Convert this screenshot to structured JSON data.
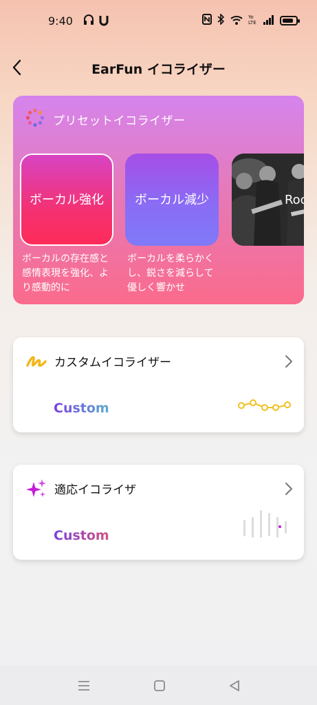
{
  "status_bar": {
    "time": "9:40",
    "battery_level": 0.85,
    "left_icons": [
      "headphones-icon",
      "magnet-icon"
    ],
    "right_icons": [
      "nfc-icon",
      "bluetooth-icon",
      "wifi-icon",
      "volte-icon",
      "signal-icon",
      "battery-icon"
    ]
  },
  "header": {
    "back_icon": "chevron-left-icon",
    "title": "EarFun イコライザー"
  },
  "preset_section": {
    "icon": "preset-dots-icon",
    "title": "プリセットイコライザー",
    "presets": [
      {
        "label": "ボーカル強化",
        "description": "ボーカルの存在感と感情表現を強化、より感動的に",
        "selected": true
      },
      {
        "label": "ボーカル減少",
        "description": "ボーカルを柔らかくし、鋭さを減らして優しく響かせ",
        "selected": false
      },
      {
        "label": "Rock",
        "description": "",
        "selected": false
      }
    ]
  },
  "custom_eq_card": {
    "icon": "custom-squiggle-icon",
    "title": "カスタムイコライザー",
    "value": "Custom",
    "chevron_icon": "chevron-right-icon",
    "graph_icon": "eq-curve-icon"
  },
  "adaptive_eq_card": {
    "icon": "sparkle-icon",
    "title": "適応イコライザ",
    "value": "Custom",
    "chevron_icon": "chevron-right-icon",
    "graph_icon": "sound-bars-icon"
  },
  "nav_bar": {
    "items": [
      "menu-icon",
      "home-icon",
      "back-triangle-icon"
    ]
  },
  "colors": {
    "preset_gradient_top": "#d584ee",
    "preset_gradient_bottom": "#fb6b8c",
    "selected_tile": "#fe2c5a",
    "curve_yellow": "#f0c020",
    "adaptive_accent": "#c51ddc"
  }
}
